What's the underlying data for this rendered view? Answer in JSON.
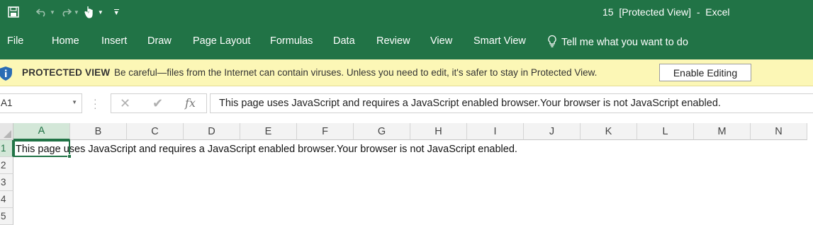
{
  "colors": {
    "accent": "#217346",
    "protected_bar": "#fcf7b6"
  },
  "titlebar": {
    "title": "15  [Protected View]  -  Excel",
    "icons": [
      "save-icon",
      "undo-icon",
      "redo-icon",
      "touch-mode-icon",
      "customize-qat-icon"
    ]
  },
  "ribbon": {
    "tabs": [
      "File",
      "Home",
      "Insert",
      "Draw",
      "Page Layout",
      "Formulas",
      "Data",
      "Review",
      "View",
      "Smart View"
    ],
    "tell_me": "Tell me what you want to do"
  },
  "protected_view": {
    "label": "PROTECTED VIEW",
    "message": "Be careful—files from the Internet can contain viruses. Unless you need to edit, it's safer to stay in Protected View.",
    "button": "Enable Editing"
  },
  "formula_bar": {
    "name_box": "A1",
    "fx_label": "fx",
    "content": "This page uses JavaScript and requires a JavaScript enabled browser.Your browser is not JavaScript enabled."
  },
  "sheet": {
    "columns": [
      "A",
      "B",
      "C",
      "D",
      "E",
      "F",
      "G",
      "H",
      "I",
      "J",
      "K",
      "L",
      "M",
      "N"
    ],
    "rows": [
      "1",
      "2",
      "3",
      "4",
      "5"
    ],
    "selected_cell": "A1",
    "cell_a1": "This page uses JavaScript and requires a JavaScript enabled browser.Your browser is not JavaScript enabled."
  }
}
